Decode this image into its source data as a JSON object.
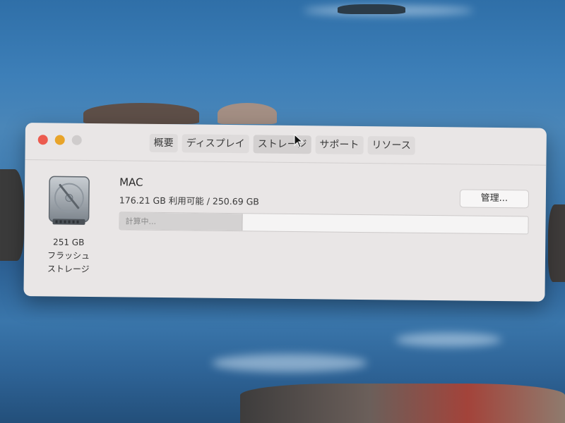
{
  "window": {
    "tabs": [
      {
        "label": "概要"
      },
      {
        "label": "ディスプレイ"
      },
      {
        "label": "ストレージ"
      },
      {
        "label": "サポート"
      },
      {
        "label": "リソース"
      }
    ],
    "active_tab": "ストレージ",
    "traffic_lights": {
      "close": "#ec5b4f",
      "minimize": "#e8a42a",
      "zoom": "#cfcccc"
    }
  },
  "storage": {
    "drive_icon": "hard-drive-icon",
    "drive_label_lines": [
      "251 GB",
      "フラッシュ",
      "ストレージ"
    ],
    "disk_name": "MAC",
    "capacity_text": "176.21 GB 利用可能 / 250.69 GB",
    "manage_button": "管理...",
    "bar_status": "計算中...",
    "bar_progress_percent": 30
  }
}
